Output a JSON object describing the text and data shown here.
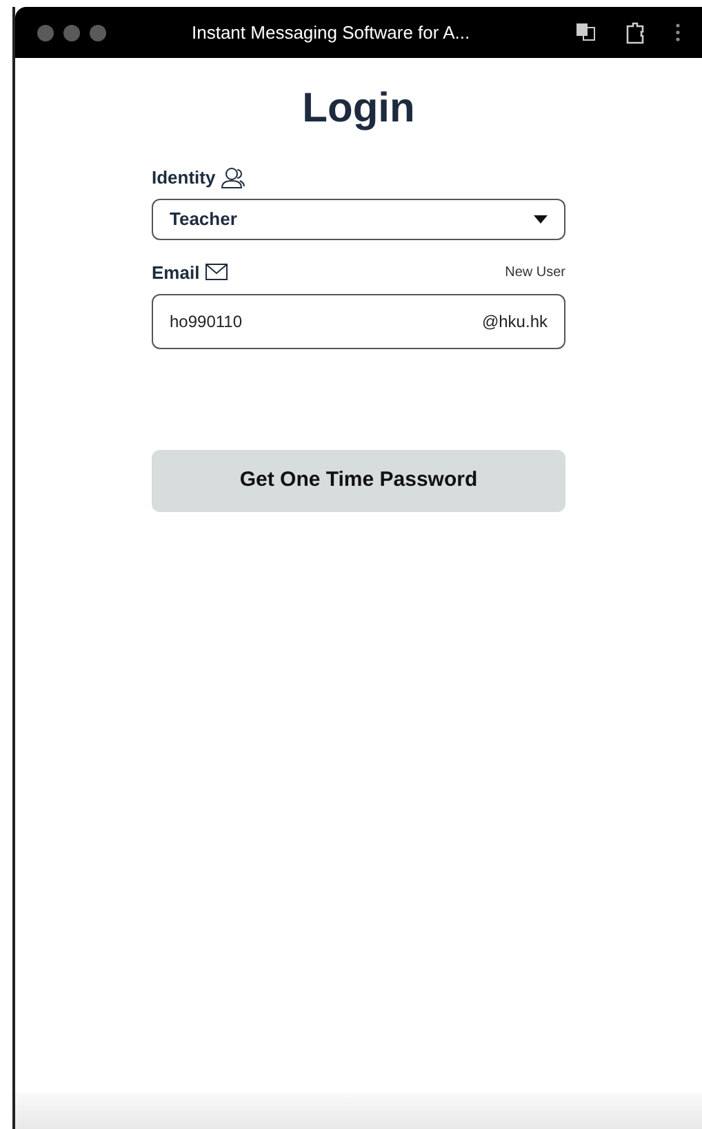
{
  "window": {
    "title": "Instant Messaging Software for A..."
  },
  "heading": "Login",
  "identity": {
    "label": "Identity",
    "value": "Teacher"
  },
  "email": {
    "label": "Email",
    "link": "New User",
    "value": "ho990110",
    "suffix": "@hku.hk"
  },
  "button": "Get One Time Password"
}
